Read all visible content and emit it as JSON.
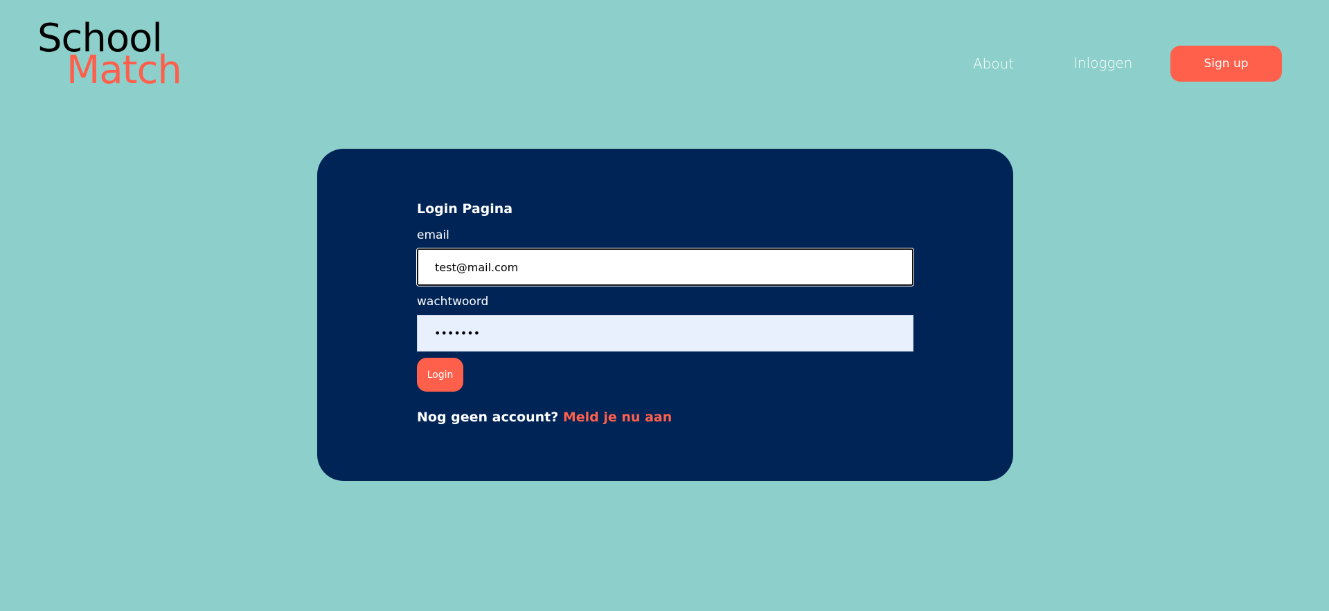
{
  "logo": {
    "line1": "School",
    "line2": "Match"
  },
  "nav": {
    "about": "About",
    "login": "Inloggen",
    "signup": "Sign up"
  },
  "login_form": {
    "title": "Login Pagina",
    "email_label": "email",
    "email_value": "test@mail.com",
    "password_label": "wachtwoord",
    "password_value": "•••••••",
    "submit_label": "Login",
    "prompt_text": "Nog geen account?",
    "prompt_link": "Meld je nu aan"
  },
  "colors": {
    "background": "#8dd0cb",
    "card": "#002456",
    "accent": "#ff604b"
  }
}
